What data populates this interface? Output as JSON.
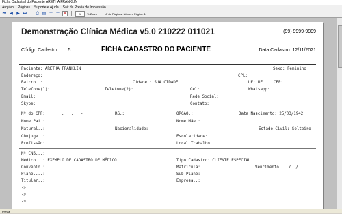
{
  "window": {
    "title": "Ficha Cadastral do Paciente ARETHA FRANKLIN",
    "menu": [
      "Arquivo",
      "Páginas",
      "Suporte e Ajuda",
      "Sair da Prévia de Impressão"
    ]
  },
  "toolbar": {
    "zoom_value": "1",
    "zoom_label": "% Zoom",
    "pages_label": "Nº de Páginas: Número Página: 1",
    "icons": [
      "first-page-icon",
      "prev-page-icon",
      "next-page-icon",
      "last-page-icon",
      "print-icon",
      "page-setup-icon",
      "zoom-in-icon",
      "zoom-out-icon",
      "close-icon"
    ]
  },
  "status": {
    "text": "Prévia"
  },
  "report": {
    "clinic": "Demonstração Clínica Médica v5.0 210222 011021",
    "phone": "(99) 9999-9999",
    "code_label": "Código Cadastro:",
    "code_value": "5",
    "form_title": "FICHA CADASTRO DO PACIENTE",
    "date_label": "Data Cadastro: 12/11/2021",
    "block1": {
      "paciente": "Paciente: ARETHA FRANKLIN",
      "sexo": "Sexo: Feminino",
      "cpl": "CPL:",
      "endereco": "Endereço:",
      "bairro": "Bairro..:",
      "cidade": "Cidade.: SUA CIDADE",
      "uf": "UF: UF",
      "cep": "CEP:",
      "telefone1": "Telefone(1):",
      "telefone2": "Telefone(2):",
      "cel": "Cel:",
      "whatsapp": "Whatsapp:",
      "email": "Email:",
      "rede": "Rede Social:",
      "skype": "Skype:",
      "contato": "Contato:"
    },
    "block2": {
      "cpf": "Nº do CPF:",
      "cpf_mask": ".   .   -",
      "rg": "RG.:",
      "orgao": "ORGAO.:",
      "nascimento": "Data Nascimento: 25/03/1942",
      "pai": "Nome Pai.:",
      "mae": "Nome Mãe.:",
      "natural": "Natural..:",
      "nacionalidade": "Nacionalidade:",
      "civil": "Estado Civil: Solteiro",
      "conjuge": "Cônjuge..:",
      "escolaridade": "Escolaridade:",
      "profissao": "Profissão:",
      "local": "Local Trabalho:"
    },
    "block3": {
      "cns": "Nº CNS...:",
      "medico": "Médico...: EXEMPLO DE CADASTRO DE MÉDICO",
      "tipo": "Tipo Cadastro: CLIENTE ESPECIAL",
      "convenio": "Convenio.:",
      "matricula": "Matricula:",
      "vencimento": "Vencimento:   /  /",
      "plano": "Plano....:",
      "subplano": "Sub Plano:",
      "titular": "Titular..:",
      "empresa": "Empresa..:",
      "arrow1": "->",
      "arrow2": "->",
      "arrow3": "->"
    }
  }
}
